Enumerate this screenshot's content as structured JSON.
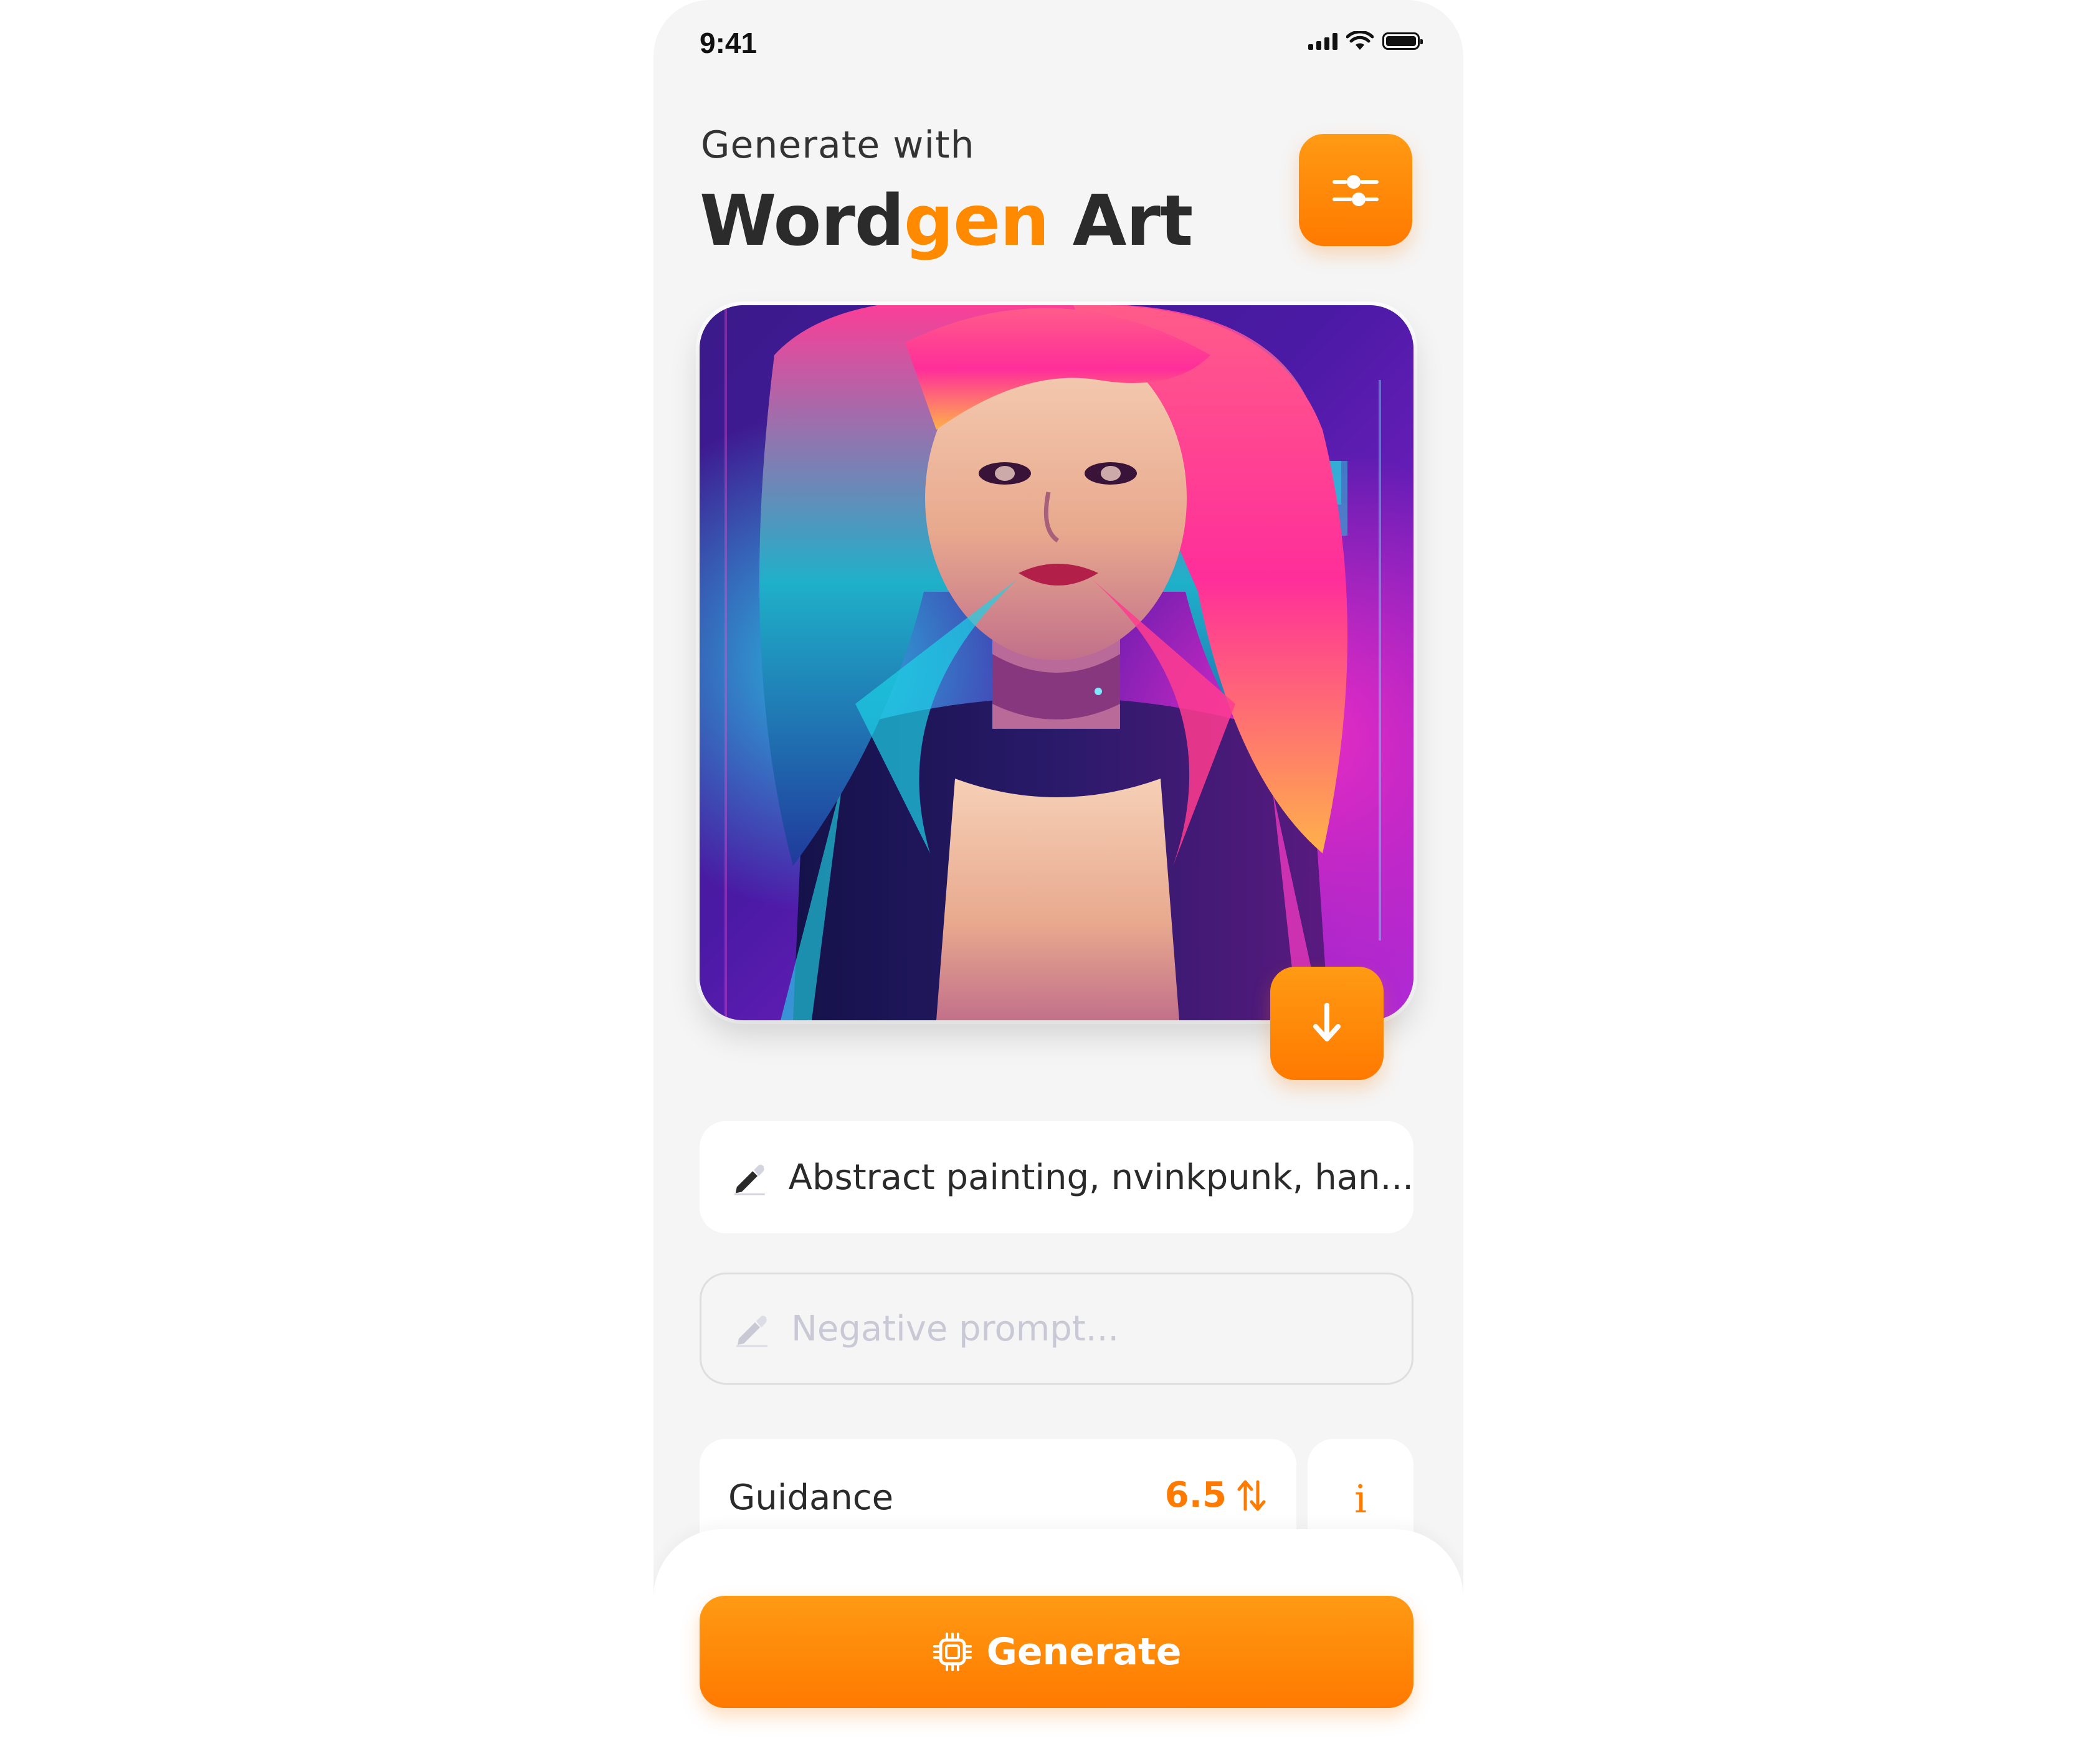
{
  "status_bar": {
    "time": "9:41"
  },
  "header": {
    "subtitle": "Generate with",
    "title_part1": "Word",
    "title_accent": "gen",
    "title_part2": " Art"
  },
  "image": {
    "alt": "Generated artwork"
  },
  "prompt": {
    "value": "Abstract painting, nvinkpunk, han..."
  },
  "negative_prompt": {
    "placeholder": "Negative prompt..."
  },
  "guidance": {
    "label": "Guidance",
    "value": "6.5"
  },
  "info": {
    "glyph": "i"
  },
  "generate": {
    "label": "Generate"
  },
  "icons": {
    "settings": "sliders-icon",
    "download": "arrow-down-icon",
    "prompt": "pen-icon",
    "negative_prompt": "pen-icon",
    "stepper": "up-down-arrows-icon",
    "generate": "chip-icon"
  },
  "colors": {
    "accent": "#ff8a00",
    "background": "#f5f5f5",
    "text": "#2b2b2b",
    "placeholder": "#c9c9d6"
  }
}
